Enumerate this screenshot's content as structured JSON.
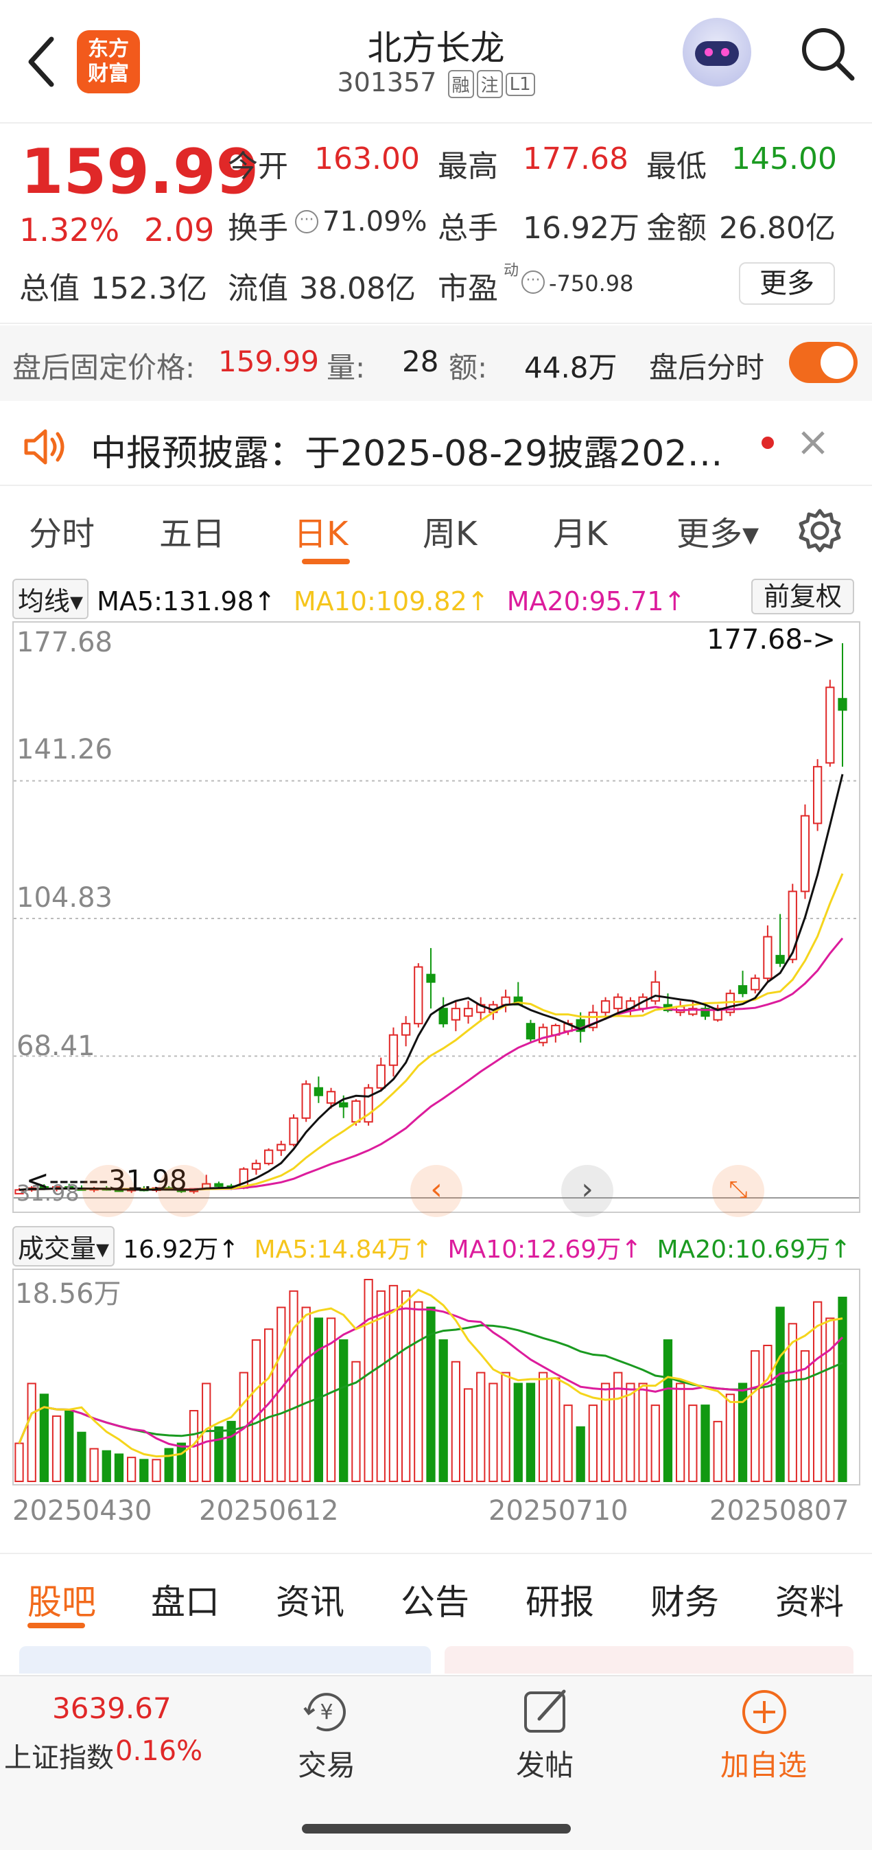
{
  "header": {
    "title": "北方长龙",
    "code": "301357",
    "tags": [
      "融",
      "注",
      "L1"
    ],
    "logo_lines": [
      "东方",
      "财富"
    ]
  },
  "quote": {
    "price": "159.99",
    "change_pct": "1.32%",
    "change": "2.09",
    "open_label": "今开",
    "open": "163.00",
    "high_label": "最高",
    "high": "177.68",
    "low_label": "最低",
    "low": "145.00",
    "turnover_label": "换手",
    "turnover": "71.09%",
    "volume_label": "总手",
    "volume": "16.92万",
    "amount_label": "金额",
    "amount": "26.80亿",
    "mcap_label": "总值",
    "mcap": "152.3亿",
    "float_label": "流值",
    "float_cap": "38.08亿",
    "pe_label": "市盈",
    "pe_sup": "动",
    "pe": "-750.98",
    "more": "更多"
  },
  "after_hours": {
    "price_label": "盘后固定价格:",
    "price": "159.99",
    "vol_label": "量:",
    "vol": "28",
    "amt_label": "额:",
    "amt": "44.8万",
    "toggle_label": "盘后分时",
    "toggle_on": true
  },
  "notice": {
    "text": "中报预披露：于2025-08-29披露202…"
  },
  "period_tabs": [
    "分时",
    "五日",
    "日K",
    "周K",
    "月K",
    "更多▾"
  ],
  "active_period": "日K",
  "ma_row": {
    "selector": "均线▾",
    "ma5": "MA5:131.98↑",
    "ma10": "MA10:109.82↑",
    "ma20": "MA20:95.71↑",
    "adjust": "前复权"
  },
  "vol_row": {
    "selector": "成交量▾",
    "vol": "16.92万↑",
    "ma5": "MA5:14.84万↑",
    "ma10": "MA10:12.69万↑",
    "ma20": "MA20:10.69万↑"
  },
  "price_axis": [
    "177.68",
    "141.26",
    "104.83",
    "68.41",
    "31.98"
  ],
  "high_marker": "177.68->",
  "low_marker": "<------31.98",
  "vol_axis_top": "18.56万",
  "dates": [
    "20250430",
    "20250612",
    "20250710",
    "20250807"
  ],
  "colors": {
    "up": "#e02828",
    "down": "#119911",
    "ma5": "#111111",
    "ma10": "#f5d51c",
    "ma20": "#dc1c9c",
    "accent": "#f26a1c"
  },
  "chart_data": [
    {
      "type": "candlestick",
      "title": "",
      "ylim": [
        31.98,
        177.68
      ],
      "candles": [
        {
          "o": 32.0,
          "h": 33.5,
          "l": 31.98,
          "c": 33.0
        },
        {
          "o": 33.0,
          "h": 34.0,
          "l": 32.5,
          "c": 33.5
        },
        {
          "o": 33.8,
          "h": 34.5,
          "l": 33.0,
          "c": 33.2
        },
        {
          "o": 33.2,
          "h": 34.0,
          "l": 32.6,
          "c": 33.8
        },
        {
          "o": 33.8,
          "h": 34.6,
          "l": 33.0,
          "c": 33.3
        },
        {
          "o": 33.3,
          "h": 34.2,
          "l": 32.8,
          "c": 33.0
        },
        {
          "o": 33.0,
          "h": 33.8,
          "l": 32.4,
          "c": 33.4
        },
        {
          "o": 33.4,
          "h": 34.0,
          "l": 32.8,
          "c": 33.0
        },
        {
          "o": 33.0,
          "h": 33.6,
          "l": 32.6,
          "c": 32.8
        },
        {
          "o": 32.8,
          "h": 33.4,
          "l": 32.2,
          "c": 33.2
        },
        {
          "o": 33.2,
          "h": 34.0,
          "l": 32.6,
          "c": 32.9
        },
        {
          "o": 32.9,
          "h": 33.8,
          "l": 32.4,
          "c": 33.5
        },
        {
          "o": 33.5,
          "h": 34.0,
          "l": 32.8,
          "c": 33.0
        },
        {
          "o": 33.0,
          "h": 33.8,
          "l": 32.2,
          "c": 32.6
        },
        {
          "o": 32.6,
          "h": 33.4,
          "l": 32.0,
          "c": 33.3
        },
        {
          "o": 33.3,
          "h": 37.0,
          "l": 33.0,
          "c": 34.6
        },
        {
          "o": 34.6,
          "h": 35.2,
          "l": 33.6,
          "c": 34.0
        },
        {
          "o": 34.0,
          "h": 34.6,
          "l": 33.0,
          "c": 33.5
        },
        {
          "o": 33.5,
          "h": 39.0,
          "l": 33.2,
          "c": 38.5
        },
        {
          "o": 38.5,
          "h": 41.0,
          "l": 37.0,
          "c": 40.0
        },
        {
          "o": 40.0,
          "h": 44.0,
          "l": 39.5,
          "c": 43.5
        },
        {
          "o": 43.5,
          "h": 46.0,
          "l": 42.0,
          "c": 45.0
        },
        {
          "o": 45.0,
          "h": 53.0,
          "l": 44.5,
          "c": 52.0
        },
        {
          "o": 52.0,
          "h": 62.0,
          "l": 51.0,
          "c": 61.0
        },
        {
          "o": 60.0,
          "h": 63.0,
          "l": 56.0,
          "c": 58.0
        },
        {
          "o": 56.0,
          "h": 60.0,
          "l": 54.5,
          "c": 59.0
        },
        {
          "o": 56.0,
          "h": 58.0,
          "l": 52.0,
          "c": 55.0
        },
        {
          "o": 51.0,
          "h": 57.0,
          "l": 50.0,
          "c": 56.5
        },
        {
          "o": 51.0,
          "h": 61.0,
          "l": 50.0,
          "c": 60.0
        },
        {
          "o": 60.0,
          "h": 68.0,
          "l": 59.0,
          "c": 66.0
        },
        {
          "o": 66.0,
          "h": 76.0,
          "l": 63.0,
          "c": 74.0
        },
        {
          "o": 74.0,
          "h": 79.0,
          "l": 71.0,
          "c": 77.0
        },
        {
          "o": 77.0,
          "h": 93.0,
          "l": 76.0,
          "c": 92.0
        },
        {
          "o": 90.0,
          "h": 97.0,
          "l": 81.0,
          "c": 88.0
        },
        {
          "o": 81.0,
          "h": 84.0,
          "l": 76.0,
          "c": 77.0
        },
        {
          "o": 78.0,
          "h": 83.0,
          "l": 75.0,
          "c": 81.0
        },
        {
          "o": 79.0,
          "h": 83.0,
          "l": 77.0,
          "c": 81.0
        },
        {
          "o": 80.0,
          "h": 84.0,
          "l": 77.5,
          "c": 82.0
        },
        {
          "o": 80.0,
          "h": 83.0,
          "l": 78.0,
          "c": 82.0
        },
        {
          "o": 82.0,
          "h": 86.0,
          "l": 80.0,
          "c": 84.0
        },
        {
          "o": 84.0,
          "h": 88.0,
          "l": 82.0,
          "c": 82.0
        },
        {
          "o": 77.0,
          "h": 78.0,
          "l": 72.0,
          "c": 73.0
        },
        {
          "o": 72.0,
          "h": 77.0,
          "l": 71.0,
          "c": 76.0
        },
        {
          "o": 74.0,
          "h": 77.0,
          "l": 72.0,
          "c": 76.5
        },
        {
          "o": 75.0,
          "h": 78.0,
          "l": 74.0,
          "c": 77.0
        },
        {
          "o": 78.0,
          "h": 80.0,
          "l": 72.0,
          "c": 75.0
        },
        {
          "o": 76.0,
          "h": 82.0,
          "l": 75.0,
          "c": 80.0
        },
        {
          "o": 80.0,
          "h": 84.0,
          "l": 78.0,
          "c": 83.0
        },
        {
          "o": 81.0,
          "h": 85.0,
          "l": 80.0,
          "c": 84.0
        },
        {
          "o": 81.0,
          "h": 84.0,
          "l": 79.0,
          "c": 83.0
        },
        {
          "o": 81.0,
          "h": 85.0,
          "l": 80.0,
          "c": 84.0
        },
        {
          "o": 83.0,
          "h": 91.0,
          "l": 82.0,
          "c": 88.0
        },
        {
          "o": 82.0,
          "h": 85.0,
          "l": 80.0,
          "c": 80.5
        },
        {
          "o": 80.0,
          "h": 83.0,
          "l": 79.0,
          "c": 81.5
        },
        {
          "o": 79.5,
          "h": 83.0,
          "l": 79.0,
          "c": 81.0
        },
        {
          "o": 81.0,
          "h": 82.0,
          "l": 78.0,
          "c": 79.0
        },
        {
          "o": 78.0,
          "h": 82.0,
          "l": 77.5,
          "c": 81.0
        },
        {
          "o": 80.0,
          "h": 86.0,
          "l": 79.0,
          "c": 85.0
        },
        {
          "o": 87.0,
          "h": 91.0,
          "l": 84.0,
          "c": 85.0
        },
        {
          "o": 86.0,
          "h": 90.0,
          "l": 85.0,
          "c": 89.0
        },
        {
          "o": 89.0,
          "h": 103.0,
          "l": 88.0,
          "c": 100.0
        },
        {
          "o": 95.0,
          "h": 106.0,
          "l": 92.0,
          "c": 93.0
        },
        {
          "o": 94.0,
          "h": 114.0,
          "l": 93.0,
          "c": 112.0
        },
        {
          "o": 112.0,
          "h": 135.0,
          "l": 110.0,
          "c": 132.0
        },
        {
          "o": 130.0,
          "h": 147.0,
          "l": 128.0,
          "c": 145.0
        },
        {
          "o": 146.0,
          "h": 168.0,
          "l": 145.0,
          "c": 166.0
        },
        {
          "o": 163.0,
          "h": 177.68,
          "l": 145.0,
          "c": 159.99
        }
      ]
    },
    {
      "type": "bar",
      "title": "",
      "ylim": [
        0,
        18.56
      ],
      "series_name": "成交量(万)",
      "values": [
        3.5,
        9.0,
        8.0,
        6.0,
        6.5,
        4.5,
        3.0,
        2.8,
        2.5,
        2.2,
        2.0,
        2.0,
        3.0,
        3.5,
        6.5,
        9.0,
        5.0,
        5.5,
        10.0,
        13.0,
        14.0,
        16.0,
        17.5,
        16.0,
        15.0,
        15.0,
        13.0,
        11.0,
        18.56,
        17.5,
        18.0,
        17.5,
        16.5,
        16.0,
        13.0,
        11.0,
        8.5,
        10.0,
        9.0,
        10.0,
        9.0,
        9.0,
        10.0,
        9.5,
        7.0,
        5.0,
        7.0,
        9.0,
        10.0,
        9.0,
        9.0,
        7.0,
        13.0,
        9.0,
        7.0,
        7.0,
        5.5,
        8.0,
        9.0,
        12.0,
        12.5,
        16.0,
        14.5,
        12.0,
        16.5,
        15.0,
        16.92
      ]
    }
  ],
  "bottom_tabs": [
    "股吧",
    "盘口",
    "资讯",
    "公告",
    "研报",
    "财务",
    "资料"
  ],
  "footer": {
    "index_value": "3639.67",
    "index_name": "上证指数",
    "index_change": "0.16%",
    "trade": "交易",
    "post": "发帖",
    "add_watch": "加自选"
  }
}
